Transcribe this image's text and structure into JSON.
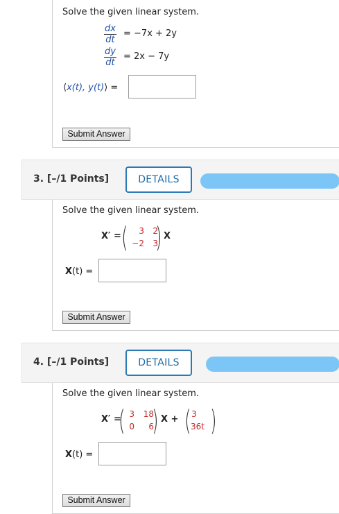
{
  "q2": {
    "prompt": "Solve the given linear system.",
    "eq1": {
      "num": "dx",
      "den": "dt",
      "rhs": "= −7x + 2y"
    },
    "eq2": {
      "num": "dy",
      "den": "dt",
      "rhs": "= 2x − 7y"
    },
    "answer_label_open": "⟨",
    "answer_label_vars": "x(t), y(t)",
    "answer_label_close": "⟩ =",
    "submit_label": "Submit Answer"
  },
  "q3": {
    "title": "3.  [–/1 Points]",
    "details_label": "DETAILS",
    "prompt": "Solve the given linear system.",
    "lhs": "X′ =",
    "matrix": [
      [
        "3",
        "2"
      ],
      [
        "−2",
        "3"
      ]
    ],
    "rhs_var": "X",
    "answer_label_var": "X",
    "answer_label_rest": "(t) =",
    "submit_label": "Submit Answer"
  },
  "q4": {
    "title": "4.  [–/1 Points]",
    "details_label": "DETAILS",
    "prompt": "Solve the given linear system.",
    "lhs": "X′ =",
    "matrix": [
      [
        "3",
        "18"
      ],
      [
        "0",
        "6"
      ]
    ],
    "rhs_var": "X +",
    "vector": [
      "3",
      "36t"
    ],
    "answer_label_var": "X",
    "answer_label_rest": "(t) =",
    "submit_label": "Submit Answer"
  },
  "colors": {
    "details_border": "#2a7ab8",
    "redaction": "#7cc6f7",
    "matrix_entries": "#c62828",
    "variables": "#1f4fa8"
  }
}
